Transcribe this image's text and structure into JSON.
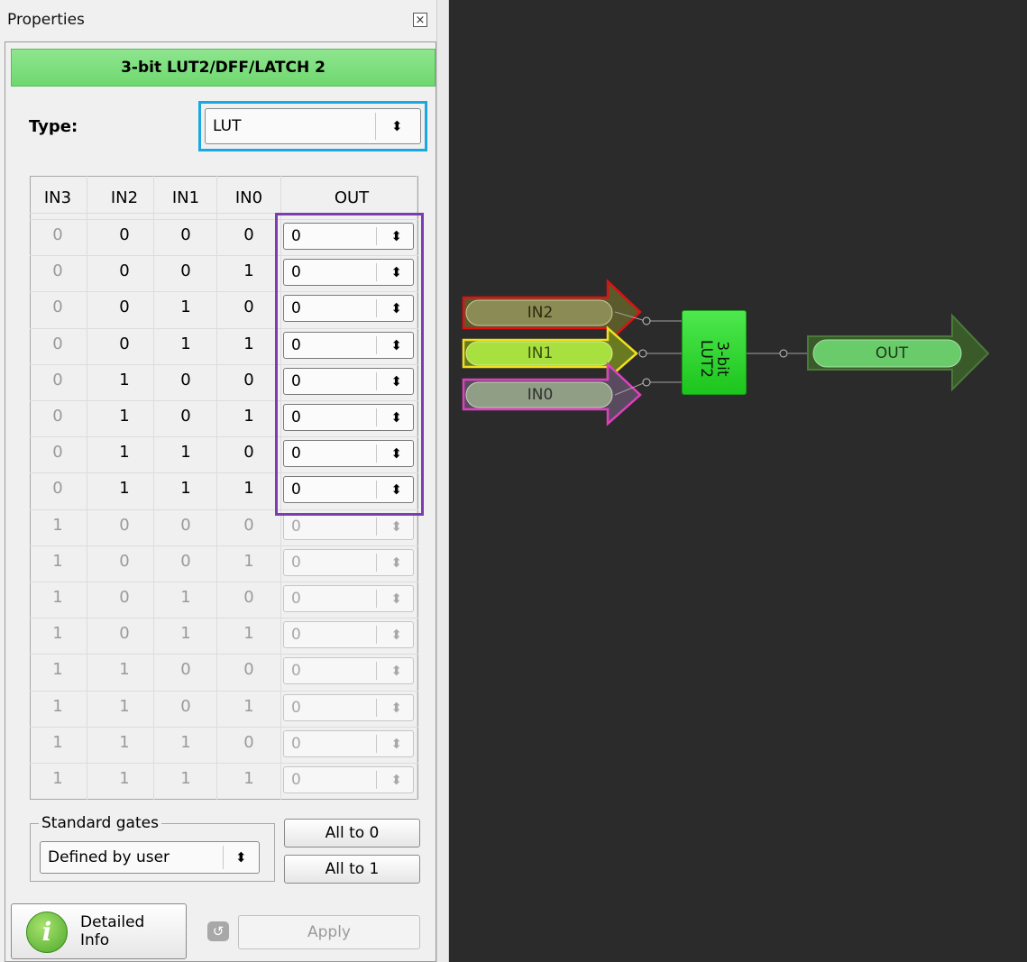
{
  "panel": {
    "title": "Properties",
    "close_icon": "close-icon",
    "header": "3-bit LUT2/DFF/LATCH 2",
    "type_label": "Type:",
    "type_value": "LUT",
    "columns": [
      "IN3",
      "IN2",
      "IN1",
      "IN0",
      "OUT"
    ],
    "rows": [
      [
        "0",
        "0",
        "0",
        "0",
        "0"
      ],
      [
        "0",
        "0",
        "0",
        "1",
        "0"
      ],
      [
        "0",
        "0",
        "1",
        "0",
        "0"
      ],
      [
        "0",
        "0",
        "1",
        "1",
        "0"
      ],
      [
        "0",
        "1",
        "0",
        "0",
        "0"
      ],
      [
        "0",
        "1",
        "0",
        "1",
        "0"
      ],
      [
        "0",
        "1",
        "1",
        "0",
        "0"
      ],
      [
        "0",
        "1",
        "1",
        "1",
        "0"
      ],
      [
        "1",
        "0",
        "0",
        "0",
        "0"
      ],
      [
        "1",
        "0",
        "0",
        "1",
        "0"
      ],
      [
        "1",
        "0",
        "1",
        "0",
        "0"
      ],
      [
        "1",
        "0",
        "1",
        "1",
        "0"
      ],
      [
        "1",
        "1",
        "0",
        "0",
        "0"
      ],
      [
        "1",
        "1",
        "0",
        "1",
        "0"
      ],
      [
        "1",
        "1",
        "1",
        "0",
        "0"
      ],
      [
        "1",
        "1",
        "1",
        "1",
        "0"
      ]
    ],
    "standard_gates_label": "Standard gates",
    "standard_gates_value": "Defined by user",
    "all_to_0": "All to 0",
    "all_to_1": "All to 1",
    "detailed_info_line1": "Detailed",
    "detailed_info_line2": "Info",
    "apply": "Apply"
  },
  "canvas": {
    "inputs": [
      {
        "label": "IN2",
        "border": "#e01010"
      },
      {
        "label": "IN1",
        "border": "#f0e020"
      },
      {
        "label": "IN0",
        "border": "#e040c0"
      }
    ],
    "block_label_line1": "3-bit",
    "block_label_line2": "LUT2",
    "output_label": "OUT"
  },
  "colors": {
    "header_green": "#7ddf7d",
    "type_highlight": "#1ba8e0",
    "out_highlight": "#7b3db1",
    "block_green": "#2fd42f",
    "canvas_bg": "#2b2b2b"
  }
}
